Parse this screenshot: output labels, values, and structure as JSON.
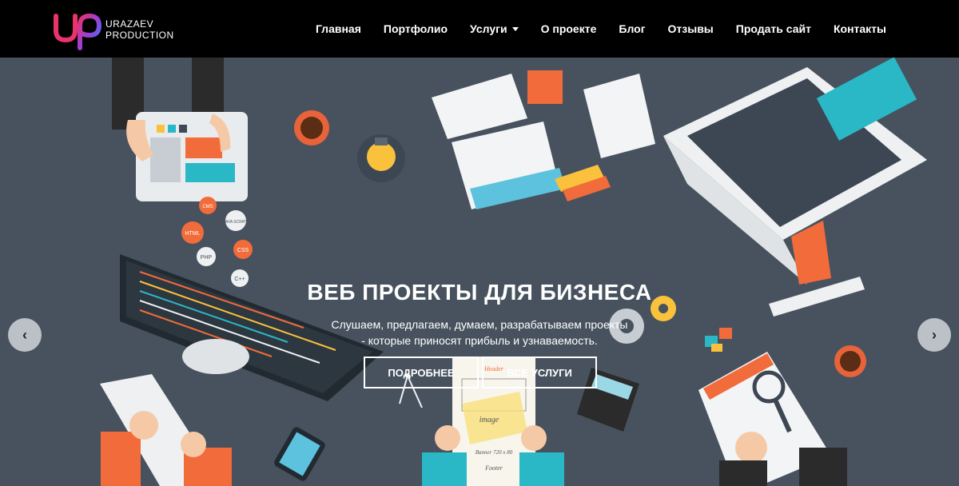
{
  "brand": {
    "line1": "URAZAEV",
    "line2": "PRODUCTION"
  },
  "nav": {
    "items": [
      {
        "label": "Главная"
      },
      {
        "label": "Портфолио"
      },
      {
        "label": "Услуги",
        "dropdown": true
      },
      {
        "label": "О проекте"
      },
      {
        "label": "Блог"
      },
      {
        "label": "Отзывы"
      },
      {
        "label": "Продать сайт"
      },
      {
        "label": "Контакты"
      }
    ]
  },
  "hero": {
    "title": "ВЕБ ПРОЕКТЫ ДЛЯ БИЗНЕСА",
    "subtitle_line1": "Слушаем, предлагаем, думаем, разрабатываем проекты",
    "subtitle_line2": "- которые приносят прибыль и узнаваемость.",
    "button_more": "ПОДРОБНЕЕ",
    "button_services": "ВСЕ УСЛУГИ"
  },
  "illustration": {
    "bubbles": [
      "CMS",
      "HTML",
      "JAVA SCRIPT",
      "PHP",
      "CSS",
      "C++"
    ],
    "wireframe": {
      "header": "Header",
      "image": "image",
      "banner": "Banner 720 x 80",
      "footer": "Footer"
    }
  },
  "carousel": {
    "prev_icon": "chevron-left-icon",
    "next_icon": "chevron-right-icon"
  },
  "colors": {
    "navbar": "#000000",
    "background": "#47525e",
    "orange": "#f26b3a",
    "teal": "#2ab7c6"
  }
}
